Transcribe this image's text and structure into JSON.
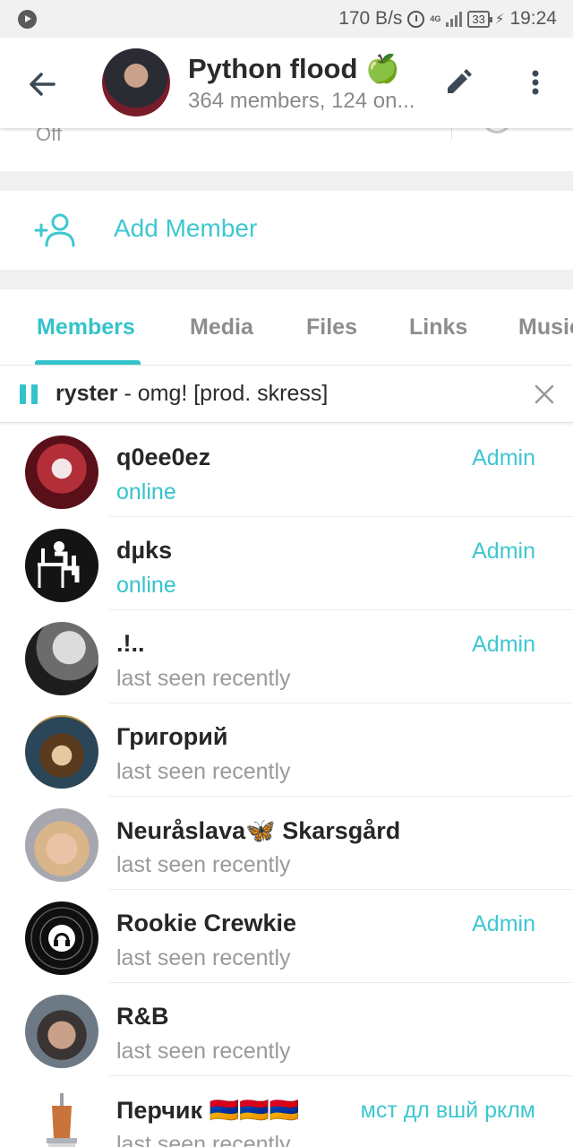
{
  "status_bar": {
    "speed": "170 B/s",
    "network": "4G",
    "battery": "33",
    "time": "19:24"
  },
  "header": {
    "title": "Python flood 🍏",
    "subtitle": "364 members, 124 on..."
  },
  "notifications": {
    "value": "Off"
  },
  "add_member": {
    "label": "Add Member"
  },
  "tabs": [
    {
      "label": "Members",
      "active": true
    },
    {
      "label": "Media",
      "active": false
    },
    {
      "label": "Files",
      "active": false
    },
    {
      "label": "Links",
      "active": false
    },
    {
      "label": "Music",
      "active": false
    }
  ],
  "player": {
    "artist": "ryster",
    "title": " - omg! [prod. skress]"
  },
  "members": [
    {
      "name": "q0ee0ez",
      "status": "online",
      "online": true,
      "role": "Admin"
    },
    {
      "name": "dµks",
      "status": "online",
      "online": true,
      "role": "Admin"
    },
    {
      "name": ".!..",
      "status": "last seen recently",
      "online": false,
      "role": "Admin"
    },
    {
      "name": "Григорий",
      "status": "last seen recently",
      "online": false,
      "role": ""
    },
    {
      "name": "Neuråslava🦋 Skarsgård",
      "status": "last seen recently",
      "online": false,
      "role": ""
    },
    {
      "name": "Rookie Crewkie",
      "status": "last seen recently",
      "online": false,
      "role": "Admin"
    },
    {
      "name": "R&B",
      "status": "last seen recently",
      "online": false,
      "role": ""
    },
    {
      "name": "Перчик 🇦🇲🇦🇲🇦🇲",
      "status": "last seen recently",
      "online": false,
      "role": "мст дл вшй рклм"
    }
  ],
  "colors": {
    "accent": "#34c3cc",
    "text_primary": "#262626",
    "text_secondary": "#9a9a9a"
  }
}
